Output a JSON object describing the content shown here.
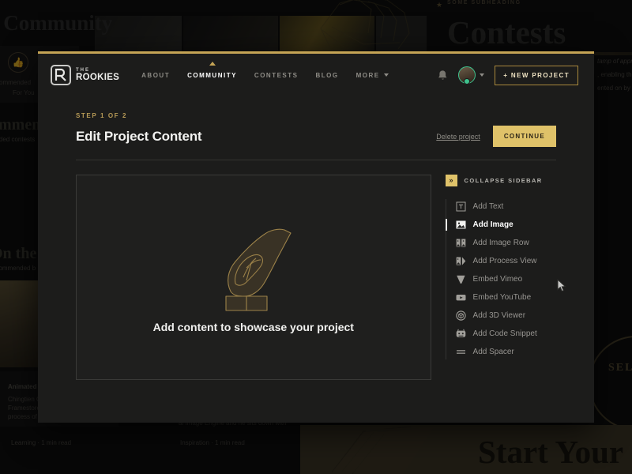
{
  "background": {
    "hero_left_heading": "r Community",
    "subheading": "SOME SUBHEADING",
    "contests_title": "Contests",
    "recommend_icon_caption_1": "commended",
    "recommend_icon_caption_2": "For You",
    "heading_recommended": "ommen",
    "sub_recommended": "ended contests",
    "heading_blog": "On the B",
    "sub_blog": "ecommended b",
    "card_title": "Animated S",
    "card_line1": "Chingtien C",
    "card_line2": "Framestore",
    "card_line3": "process of c",
    "card_meta_left": "Learning  ·  1 min read",
    "card_meta_right": "Inspiration  ·  1 min read",
    "card_body_right": "al Image Engine and he sits down with",
    "right_line1": "tamp of appr",
    "right_line2": ", enabling th",
    "right_line3": "ented on by i",
    "badge_text": "SELECT",
    "start_heading": "Start Your"
  },
  "navbar": {
    "logo_the": "THE",
    "logo_rookies": "ROOKIES",
    "links": [
      {
        "label": "ABOUT",
        "active": false
      },
      {
        "label": "COMMUNITY",
        "active": true
      },
      {
        "label": "CONTESTS",
        "active": false
      },
      {
        "label": "BLOG",
        "active": false
      }
    ],
    "more_label": "MORE",
    "bell_icon": "bell-icon",
    "avatar_icon": "avatar",
    "new_project_label": "+ NEW PROJECT"
  },
  "header": {
    "step": "STEP 1 OF 2",
    "title": "Edit Project Content",
    "delete_label": "Delete project",
    "continue_label": "CONTINUE"
  },
  "canvas": {
    "empty_text": "Add content to showcase your project",
    "illustration": "hand-placing-blocks-illustration"
  },
  "sidebar": {
    "collapse_icon": "»",
    "collapse_label": "COLLAPSE SIDEBAR",
    "items": [
      {
        "label": "Add Text",
        "icon": "text-box-icon",
        "active": false
      },
      {
        "label": "Add Image",
        "icon": "image-icon",
        "active": true
      },
      {
        "label": "Add Image Row",
        "icon": "image-row-icon",
        "active": false
      },
      {
        "label": "Add Process View",
        "icon": "process-view-icon",
        "active": false
      },
      {
        "label": "Embed Vimeo",
        "icon": "vimeo-icon",
        "active": false
      },
      {
        "label": "Embed YouTube",
        "icon": "youtube-icon",
        "active": false
      },
      {
        "label": "Add 3D Viewer",
        "icon": "cube-3d-icon",
        "active": false
      },
      {
        "label": "Add Code Snippet",
        "icon": "code-snippet-icon",
        "active": false
      },
      {
        "label": "Add Spacer",
        "icon": "spacer-icon",
        "active": false
      }
    ]
  },
  "colors": {
    "gold": "#dfc269",
    "gold_border": "#c5a455",
    "modal_bg": "#1c1c1b",
    "canvas_bg": "#1f1f1e",
    "online_green": "#3ec28d"
  }
}
